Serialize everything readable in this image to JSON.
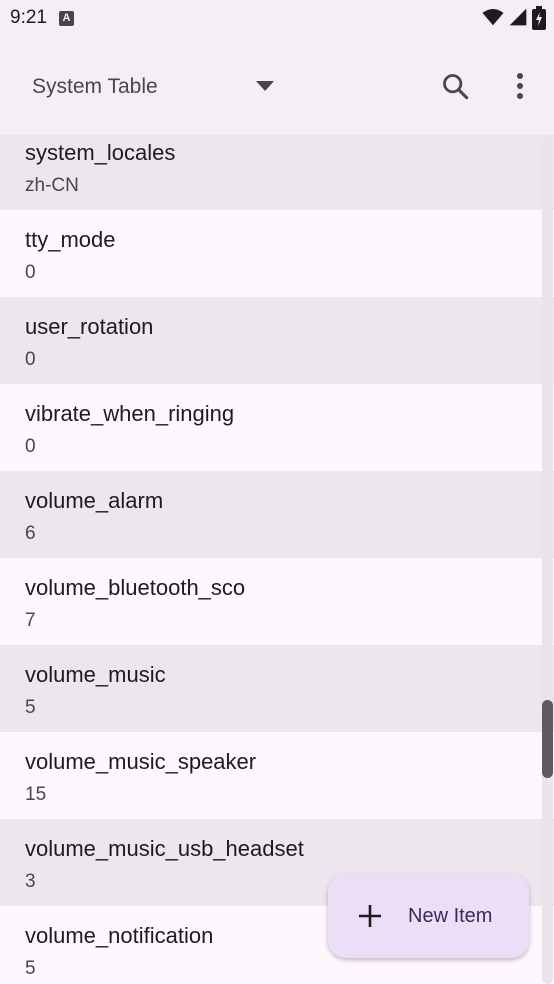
{
  "status_bar": {
    "time": "9:21",
    "notification_icon": "a-icon",
    "icons": [
      "wifi-icon",
      "signal-icon",
      "battery-icon"
    ]
  },
  "app_bar": {
    "table_selector": {
      "selected": "System Table"
    },
    "search_icon": "search-icon",
    "overflow_icon": "more-vert-icon"
  },
  "list": {
    "items": [
      {
        "key": "system_locales",
        "value": "zh-CN"
      },
      {
        "key": "tty_mode",
        "value": "0"
      },
      {
        "key": "user_rotation",
        "value": "0"
      },
      {
        "key": "vibrate_when_ringing",
        "value": "0"
      },
      {
        "key": "volume_alarm",
        "value": "6"
      },
      {
        "key": "volume_bluetooth_sco",
        "value": "7"
      },
      {
        "key": "volume_music",
        "value": "5"
      },
      {
        "key": "volume_music_speaker",
        "value": "15"
      },
      {
        "key": "volume_music_usb_headset",
        "value": "3"
      },
      {
        "key": "volume_notification",
        "value": "5"
      }
    ]
  },
  "fab": {
    "label": "New Item",
    "icon": "add-icon"
  },
  "colors": {
    "background": "#f3eff5",
    "row_alt": "#ece7ed",
    "row_normal": "#fdf7fe",
    "fab": "#ebdff8"
  }
}
